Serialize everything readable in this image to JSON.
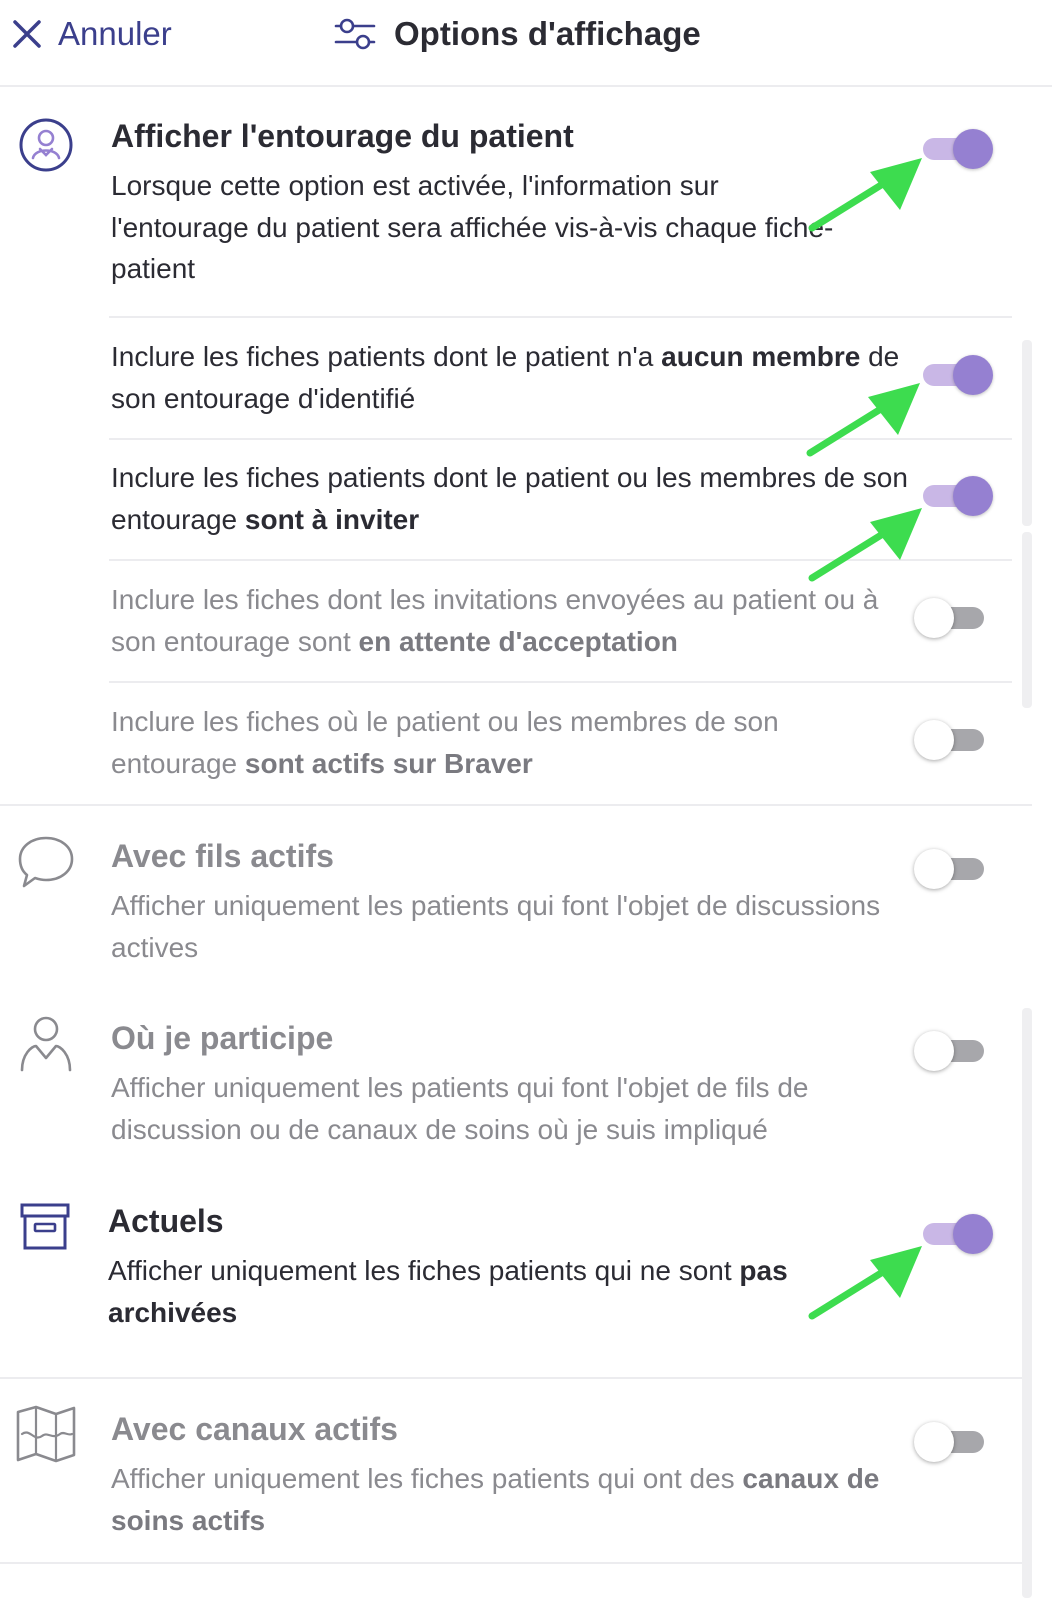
{
  "header": {
    "cancel_label": "Annuler",
    "title": "Options d'affichage"
  },
  "sections": {
    "entourage": {
      "title": "Afficher l'entourage du patient",
      "description": "Lorsque cette option est activée, l'information sur l'entourage du patient sera affichée vis-à-vis chaque fiche-patient",
      "enabled": true,
      "icon": "user-circle-icon"
    },
    "sub_options": [
      {
        "text_before": "Inclure les fiches patients dont le patient n'a ",
        "bold": "aucun membre",
        "text_after": " de son entourage d'identifié",
        "enabled": true
      },
      {
        "text_before": "Inclure les fiches patients dont le patient ou les membres de son entourage ",
        "bold": "sont à inviter",
        "text_after": "",
        "enabled": true
      },
      {
        "text_before": "Inclure les fiches dont les invitations envoyées au patient ou à son entourage sont ",
        "bold": "en attente d'acceptation",
        "text_after": "",
        "enabled": false
      },
      {
        "text_before": "Inclure les fiches où le patient ou les membres de son entourage ",
        "bold": "sont actifs sur Braver",
        "text_after": "",
        "enabled": false
      }
    ],
    "fils_actifs": {
      "title": "Avec fils actifs",
      "description": "Afficher uniquement les patients qui font l'objet de discussions actives",
      "enabled": false,
      "icon": "speech-bubble-icon"
    },
    "participe": {
      "title": "Où je participe",
      "description": "Afficher uniquement les patients qui font l'objet de fils de discussion ou de canaux de soins où je suis impliqué",
      "enabled": false,
      "icon": "person-icon"
    },
    "actuels": {
      "title": "Actuels",
      "desc_before": "Afficher uniquement les fiches patients qui ne sont ",
      "desc_bold": "pas archivées",
      "enabled": true,
      "icon": "archive-box-icon"
    },
    "canaux_actifs": {
      "title": "Avec canaux actifs",
      "desc_before": "Afficher uniquement les fiches patients qui ont des ",
      "desc_bold": "canaux de soins actifs",
      "enabled": false,
      "icon": "map-icon"
    }
  },
  "colors": {
    "accent": "#9580d1",
    "accent_track": "#c9b7e6",
    "header_link": "#3b3f8c",
    "arrow": "#3ddc4f"
  }
}
